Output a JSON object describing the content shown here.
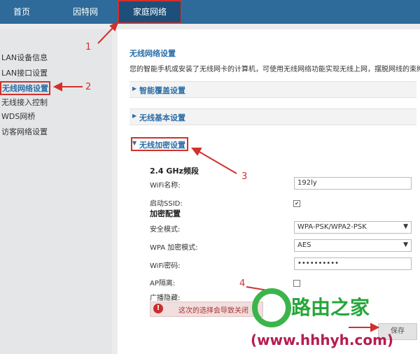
{
  "nav": {
    "tabs": [
      {
        "label": "首页"
      },
      {
        "label": "因特网"
      },
      {
        "label": "家庭网络"
      }
    ]
  },
  "sidebar": {
    "items": [
      {
        "label": "LAN设备信息"
      },
      {
        "label": "LAN接口设置"
      },
      {
        "label": "无线网络设置"
      },
      {
        "label": "无线接入控制"
      },
      {
        "label": "WDS网桥"
      },
      {
        "label": "访客网络设置"
      }
    ]
  },
  "main": {
    "title": "无线网络设置",
    "description": "您的智能手机或安装了无线网卡的计算机，可使用无线网络功能实现无线上网，摆脱网线的束缚。",
    "sections": [
      {
        "label": "智能覆盖设置"
      },
      {
        "label": "无线基本设置"
      },
      {
        "label": "无线加密设置"
      }
    ],
    "band_title": "2.4 GHz频段",
    "fields": {
      "wifi_name_label": "WiFi名称:",
      "wifi_name_value": "192ly",
      "enable_ssid_label": "启动SSID:",
      "encryption_config_label": "加密配置",
      "security_mode_label": "安全模式:",
      "security_mode_value": "WPA-PSK/WPA2-PSK",
      "wpa_mode_label": "WPA 加密模式:",
      "wpa_mode_value": "AES",
      "wifi_password_label": "WiFi密码:",
      "wifi_password_value": "••••••••••",
      "ap_isolation_label": "AP隔离:",
      "broadcast_hide_label": "广播隐藏:"
    },
    "warning": "这次的选择会导致关闭",
    "save_label": "保存"
  },
  "annotations": [
    "1",
    "2",
    "3",
    "4"
  ],
  "watermark": {
    "logo_text": "路由之家",
    "url": "(www.hhhyh.com)"
  },
  "colors": {
    "nav_bg": "#2e6b9a",
    "accent_blue": "#2b6ea8",
    "annotation_red": "#d0312d",
    "logo_green": "#3bb54a"
  }
}
